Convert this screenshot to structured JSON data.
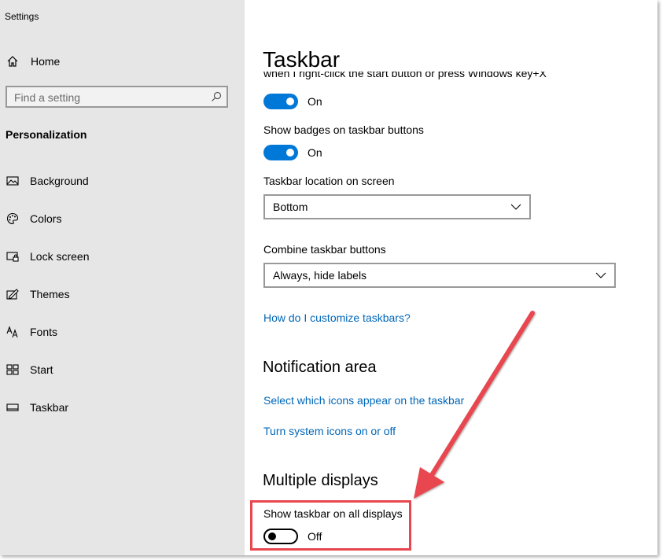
{
  "app": {
    "title": "Settings"
  },
  "sidebar": {
    "home_label": "Home",
    "search_placeholder": "Find a setting",
    "section_title": "Personalization",
    "items": [
      {
        "label": "Background",
        "icon": "picture-icon"
      },
      {
        "label": "Colors",
        "icon": "palette-icon"
      },
      {
        "label": "Lock screen",
        "icon": "lock-screen-icon"
      },
      {
        "label": "Themes",
        "icon": "themes-icon"
      },
      {
        "label": "Fonts",
        "icon": "fonts-icon"
      },
      {
        "label": "Start",
        "icon": "start-icon"
      },
      {
        "label": "Taskbar",
        "icon": "taskbar-icon"
      }
    ]
  },
  "main": {
    "title": "Taskbar",
    "cropped_setting_text": "when I right-click the start button or press Windows key+X",
    "replace_cmd_toggle": {
      "state": "On"
    },
    "badges": {
      "label": "Show badges on taskbar buttons",
      "state": "On"
    },
    "location": {
      "label": "Taskbar location on screen",
      "value": "Bottom"
    },
    "combine": {
      "label": "Combine taskbar buttons",
      "value": "Always, hide labels"
    },
    "customize_link": "How do I customize taskbars?",
    "notification_area": {
      "heading": "Notification area",
      "link1": "Select which icons appear on the taskbar",
      "link2": "Turn system icons on or off"
    },
    "multiple_displays": {
      "heading": "Multiple displays",
      "label": "Show taskbar on all displays",
      "state": "Off"
    }
  },
  "colors": {
    "accent": "#0078d7",
    "link": "#0067b8",
    "sidebar_bg": "#e6e6e6",
    "annotation": "#e8474f"
  }
}
